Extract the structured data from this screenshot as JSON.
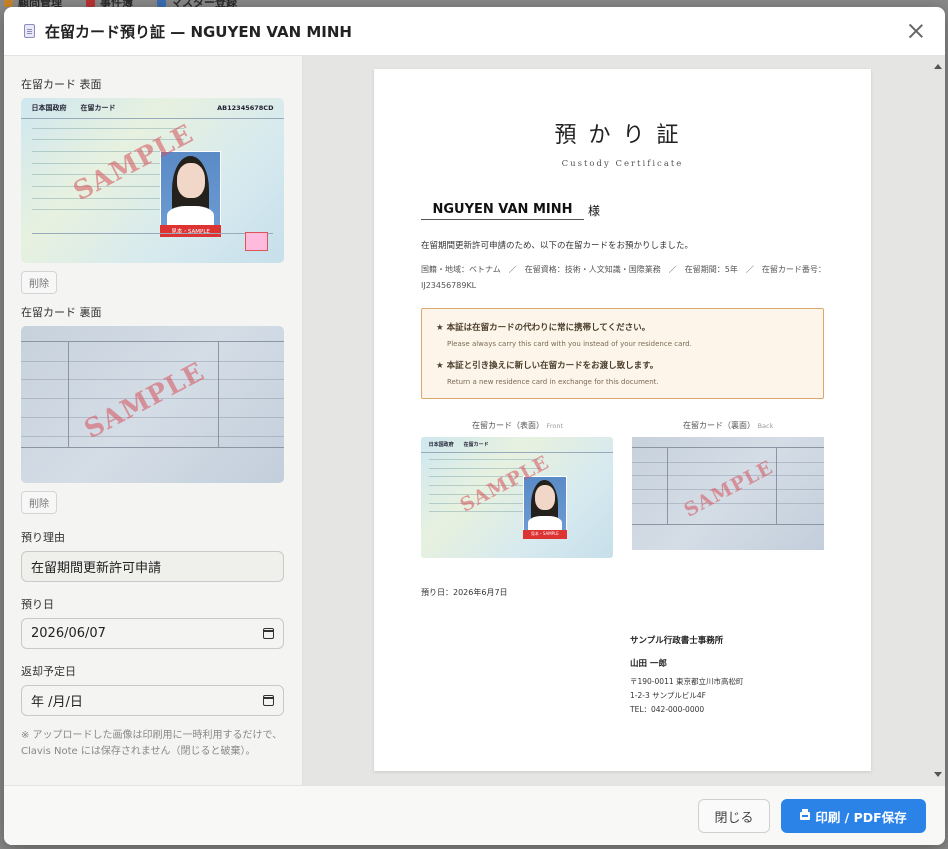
{
  "background_nav": [
    "顧問管理",
    "事件簿",
    "マスター登録"
  ],
  "modal": {
    "title": "在留カード預り証 — NGUYEN VAN MINH"
  },
  "left": {
    "front_label": "在留カード 表面",
    "back_label": "在留カード 裏面",
    "delete_label": "削除",
    "reason_label": "預り理由",
    "reason_value": "在留期間更新許可申請",
    "custody_date_label": "預り日",
    "custody_date_value": "2026/06/07",
    "return_date_label": "返却予定日",
    "return_date_value": "年 /月/日",
    "note": "※ アップロードした画像は印刷用に一時利用するだけで、Clavis Note には保存されません（閉じると破棄）。"
  },
  "card_art": {
    "header": "日本国政府　　在留カード",
    "number": "AB12345678CD",
    "watermark": "SAMPLE",
    "badge": "見本・SAMPLE"
  },
  "paper": {
    "title": "預かり証",
    "subtitle": "Custody Certificate",
    "name": "NGUYEN VAN MINH",
    "honorific": "様",
    "intro": "在留期間更新許可申請のため、以下の在留カードをお預かりしました。",
    "meta": "国籍・地域：ベトナム　／　在留資格：技術・人文知識・国際業務　／　在留期間：5年　／　在留カード番号：IJ23456789KL",
    "notice_1_jp": "★ 本証は在留カードの代わりに常に携帯してください。",
    "notice_1_en": "Please always carry this card with you instead of your residence card.",
    "notice_2_jp": "★ 本証と引き換えに新しい在留カードをお渡し致します。",
    "notice_2_en": "Return a new residence card in exchange for this document.",
    "front_caption": "在留カード（表面）",
    "front_caption_en": "Front",
    "back_caption": "在留カード（裏面）",
    "back_caption_en": "Back",
    "date": "預り日：2026年6月7日",
    "office": "サンプル行政書士事務所",
    "person": "山田 一郎",
    "address_1": "〒190-0011 東京都立川市高松町",
    "address_2": "1-2-3 サンプルビル4F",
    "tel": "TEL：042-000-0000"
  },
  "footer": {
    "close_label": "閉じる",
    "print_label": "印刷 / PDF保存"
  },
  "colors": {
    "primary": "#2b83e8",
    "notice_border": "#d9a76b",
    "watermark": "#d6505a"
  }
}
